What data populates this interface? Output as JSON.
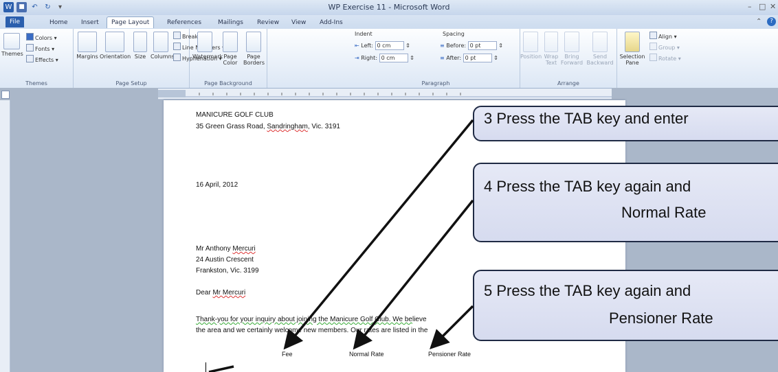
{
  "window": {
    "title": "WP Exercise 11 - Microsoft Word"
  },
  "tabs": [
    "File",
    "Home",
    "Insert",
    "Page Layout",
    "References",
    "Mailings",
    "Review",
    "View",
    "Add-Ins"
  ],
  "ribbon": {
    "themes": {
      "themes_label": "Themes",
      "colors": "Colors",
      "fonts": "Fonts",
      "effects": "Effects",
      "group": "Themes"
    },
    "page_setup": {
      "margins": "Margins",
      "orientation": "Orientation",
      "size": "Size",
      "columns": "Columns",
      "breaks": "Breaks",
      "line_numbers": "Line Numbers",
      "hyphenation": "Hyphenation",
      "group": "Page Setup"
    },
    "page_background": {
      "watermark": "Watermark",
      "page_color": "Page Color",
      "page_borders": "Page Borders",
      "group": "Page Background"
    },
    "paragraph": {
      "indent": "Indent",
      "left_label": "Left:",
      "left_value": "0 cm",
      "right_label": "Right:",
      "right_value": "0 cm",
      "spacing": "Spacing",
      "before_label": "Before:",
      "before_value": "0 pt",
      "after_label": "After:",
      "after_value": "0 pt",
      "group": "Paragraph"
    },
    "arrange": {
      "position": "Position",
      "wrap_text": "Wrap Text",
      "bring_forward": "Bring Forward",
      "send_backward": "Send Backward",
      "selection_pane": "Selection Pane",
      "align": "Align",
      "group_btn": "Group",
      "rotate": "Rotate",
      "group": "Arrange"
    }
  },
  "document": {
    "club": "MANICURE GOLF CLUB",
    "address_pre": "35 Green Grass Road, ",
    "address_town": "Sandringham",
    "address_post": ", Vic. 3191",
    "date": "16 April, 2012",
    "recipient_pre": "Mr Anthony ",
    "recipient_name": "Mercuri",
    "street": "24 Austin Crescent",
    "city": "Frankston, Vic. 3199",
    "greeting_pre": "Dear ",
    "greeting_name": "Mr Mercuri",
    "body_line1_pre": "Thank-you for your inquiry about joining the Manicure Golf Club.  We be",
    "body_line1_post": "lieve",
    "body_line2": "the area and we certainly welcome new members. Our rates are listed in the",
    "col1": "Fee",
    "col2": "Normal Rate",
    "col3": "Pensioner Rate"
  },
  "callouts": [
    {
      "line1": "3  Press the TAB key and enter"
    },
    {
      "line1": "4  Press the TAB key again and",
      "line2": "Normal Rate"
    },
    {
      "line1": "5  Press the TAB key again and",
      "line2": "Pensioner Rate"
    }
  ],
  "colors": {
    "file_tab": "#2b5fad",
    "callout_fill": "#dde1f2",
    "callout_border": "#1f2a44"
  }
}
